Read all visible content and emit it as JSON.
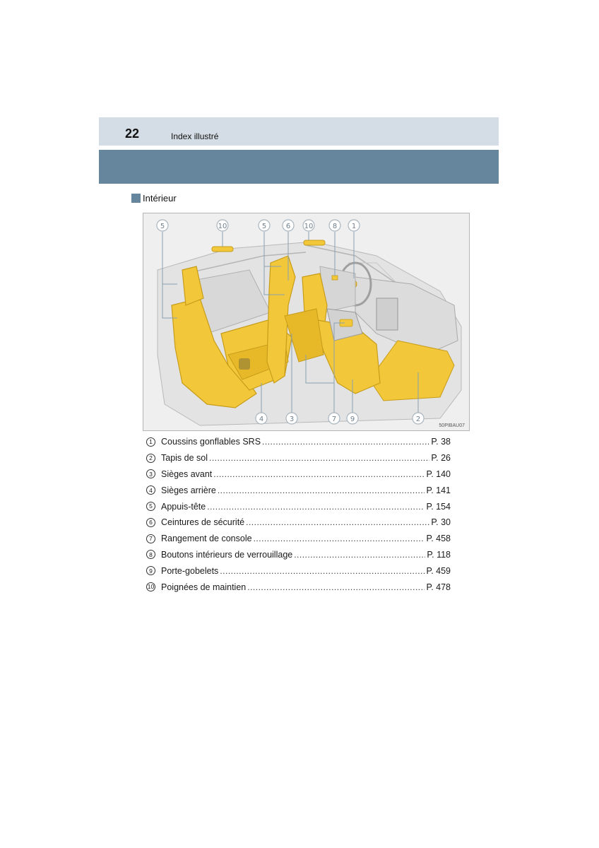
{
  "header": {
    "page_number": "22",
    "title": "Index illustré"
  },
  "section": {
    "title": "Intérieur"
  },
  "figure": {
    "code": "50PIBAU07",
    "callouts": [
      "5",
      "10",
      "5",
      "6",
      "10",
      "8",
      "1",
      "4",
      "3",
      "7",
      "9",
      "2"
    ]
  },
  "legend": [
    {
      "num": "1",
      "label": "Coussins gonflables SRS",
      "page": "P. 38"
    },
    {
      "num": "2",
      "label": "Tapis de sol",
      "page": "P. 26"
    },
    {
      "num": "3",
      "label": "Sièges avant",
      "page": "P. 140"
    },
    {
      "num": "4",
      "label": "Sièges arrière",
      "page": "P. 141"
    },
    {
      "num": "5",
      "label": "Appuis-tête",
      "page": "P. 154"
    },
    {
      "num": "6",
      "label": "Ceintures de sécurité",
      "page": "P. 30"
    },
    {
      "num": "7",
      "label": "Rangement de console",
      "page": "P. 458"
    },
    {
      "num": "8",
      "label": "Boutons intérieurs de verrouillage",
      "page": "P. 118"
    },
    {
      "num": "9",
      "label": "Porte-gobelets",
      "page": "P. 459"
    },
    {
      "num": "10",
      "label": "Poignées de maintien",
      "page": "P. 478"
    }
  ],
  "colors": {
    "header_bar": "#d4dde5",
    "blue_band": "#65869c",
    "seat_yellow": "#f2c83a"
  }
}
